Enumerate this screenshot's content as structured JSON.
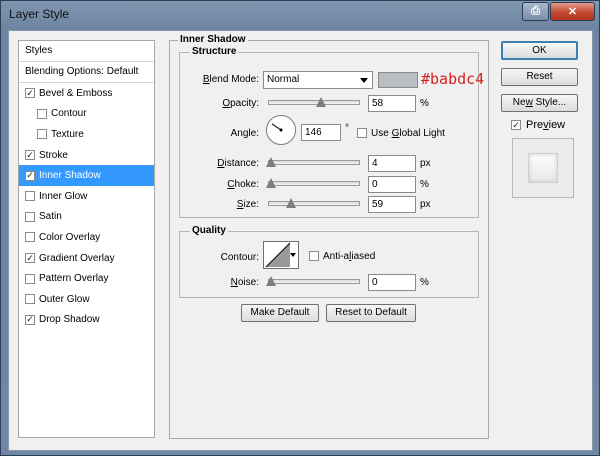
{
  "window": {
    "title": "Layer Style"
  },
  "titlebar": {
    "help_icon": "help-icon",
    "close_icon": "close-icon"
  },
  "styles_panel": {
    "header": "Styles",
    "blending_options": "Blending Options: Default",
    "items": [
      {
        "label": "Bevel & Emboss",
        "checked": true,
        "indent": false
      },
      {
        "label": "Contour",
        "checked": false,
        "indent": true
      },
      {
        "label": "Texture",
        "checked": false,
        "indent": true
      },
      {
        "label": "Stroke",
        "checked": true,
        "indent": false
      },
      {
        "label": "Inner Shadow",
        "checked": true,
        "indent": false,
        "selected": true
      },
      {
        "label": "Inner Glow",
        "checked": false,
        "indent": false
      },
      {
        "label": "Satin",
        "checked": false,
        "indent": false
      },
      {
        "label": "Color Overlay",
        "checked": false,
        "indent": false
      },
      {
        "label": "Gradient Overlay",
        "checked": true,
        "indent": false
      },
      {
        "label": "Pattern Overlay",
        "checked": false,
        "indent": false
      },
      {
        "label": "Outer Glow",
        "checked": false,
        "indent": false
      },
      {
        "label": "Drop Shadow",
        "checked": true,
        "indent": false
      }
    ]
  },
  "inner_shadow": {
    "section_title": "Inner Shadow",
    "structure_title": "Structure",
    "blend_mode": {
      "label_first": "B",
      "label_rest": "lend Mode:",
      "value": "Normal",
      "color_hex": "#babdc4",
      "color_note": "#babdc4"
    },
    "opacity": {
      "label_first": "O",
      "label_rest": "pacity:",
      "value": "58",
      "unit": "%",
      "fraction": 0.58
    },
    "angle": {
      "label": "Angle:",
      "value": "146",
      "unit": "°",
      "use_global_light_pre": "Use ",
      "use_global_light_u": "G",
      "use_global_light_post": "lobal Light",
      "global_light_checked": false
    },
    "distance": {
      "label_first": "D",
      "label_rest": "istance:",
      "value": "4",
      "unit": "px",
      "fraction": 0.0
    },
    "choke": {
      "label_first": "C",
      "label_rest": "hoke:",
      "value": "0",
      "unit": "%",
      "fraction": 0.0
    },
    "size": {
      "label_first": "S",
      "label_rest": "ize:",
      "value": "59",
      "unit": "px",
      "fraction": 0.23
    },
    "quality_title": "Quality",
    "contour": {
      "label": "Contour:",
      "anti_aliased_pre": "Anti-a",
      "anti_aliased_u": "l",
      "anti_aliased_post": "iased",
      "anti_aliased_checked": false
    },
    "noise": {
      "label_first": "N",
      "label_rest": "oise:",
      "value": "0",
      "unit": "%",
      "fraction": 0.0
    },
    "make_default": "Make Default",
    "reset_default": "Reset to Default"
  },
  "actions": {
    "ok": "OK",
    "reset": "Reset",
    "new_style_pre": "Ne",
    "new_style_u": "w",
    "new_style_post": " Style...",
    "preview_pre": "Pre",
    "preview_u": "v",
    "preview_post": "iew",
    "preview_checked": true
  }
}
